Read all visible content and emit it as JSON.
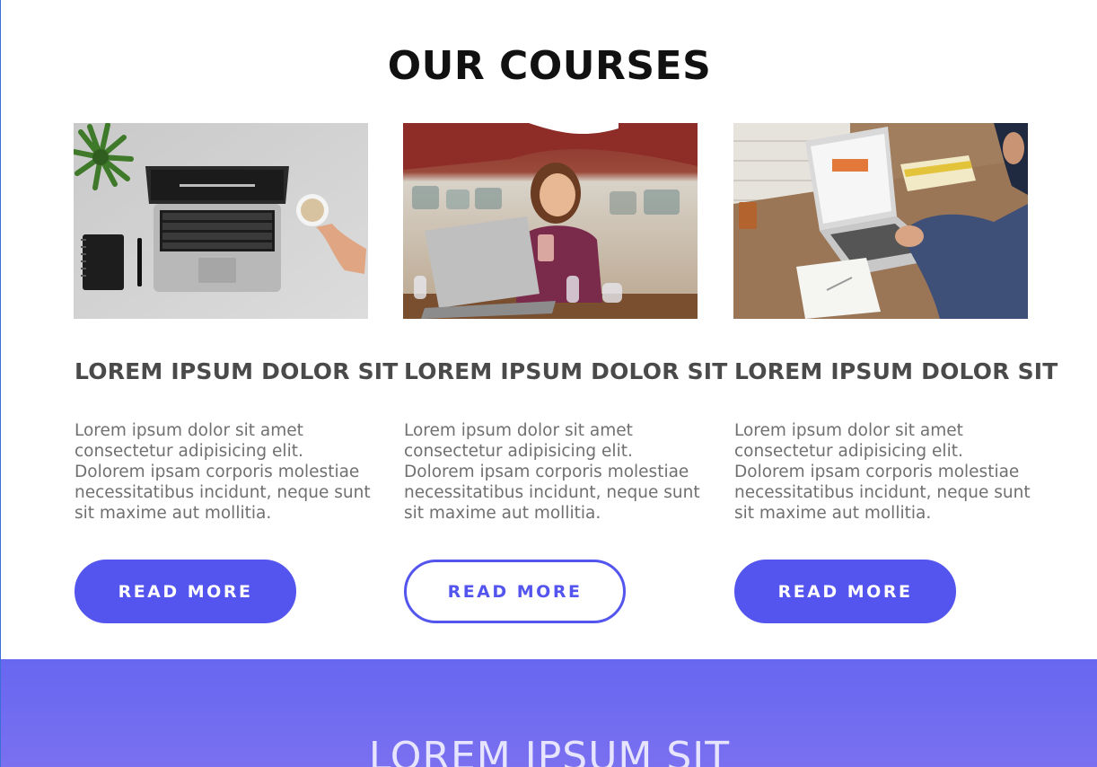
{
  "section": {
    "title": "OUR COURSES"
  },
  "courses": [
    {
      "title": "LOREM IPSUM DOLOR SIT",
      "text": "Lorem ipsum dolor sit amet consectetur adipisicing elit. Dolorem ipsam corporis molestiae necessitatibus incidunt, neque sunt sit maxime aut mollitia.",
      "button_label": "READ MORE",
      "button_style": "solid",
      "image": "laptop-coffee-desk-photo"
    },
    {
      "title": "LOREM IPSUM DOLOR SIT",
      "text": "Lorem ipsum dolor sit amet consectetur adipisicing elit. Dolorem ipsam corporis molestiae necessitatibus incidunt, neque sunt sit maxime aut mollitia.",
      "button_label": "READ MORE",
      "button_style": "outline",
      "image": "woman-cafe-laptop-photo"
    },
    {
      "title": "LOREM IPSUM DOLOR SIT",
      "text": "Lorem ipsum dolor sit amet consectetur adipisicing elit. Dolorem ipsam corporis molestiae necessitatibus incidunt, neque sunt sit maxime aut mollitia.",
      "button_label": "READ MORE",
      "button_style": "solid",
      "image": "person-typing-laptop-photo"
    }
  ],
  "banner": {
    "title": "LOREM IPSUM SIT"
  },
  "colors": {
    "accent": "#5454ee",
    "banner_top": "#6767f0",
    "banner_bottom": "#7a70f0",
    "title_text": "#111111",
    "card_title_text": "#4a4a4a",
    "body_text": "#707070"
  }
}
